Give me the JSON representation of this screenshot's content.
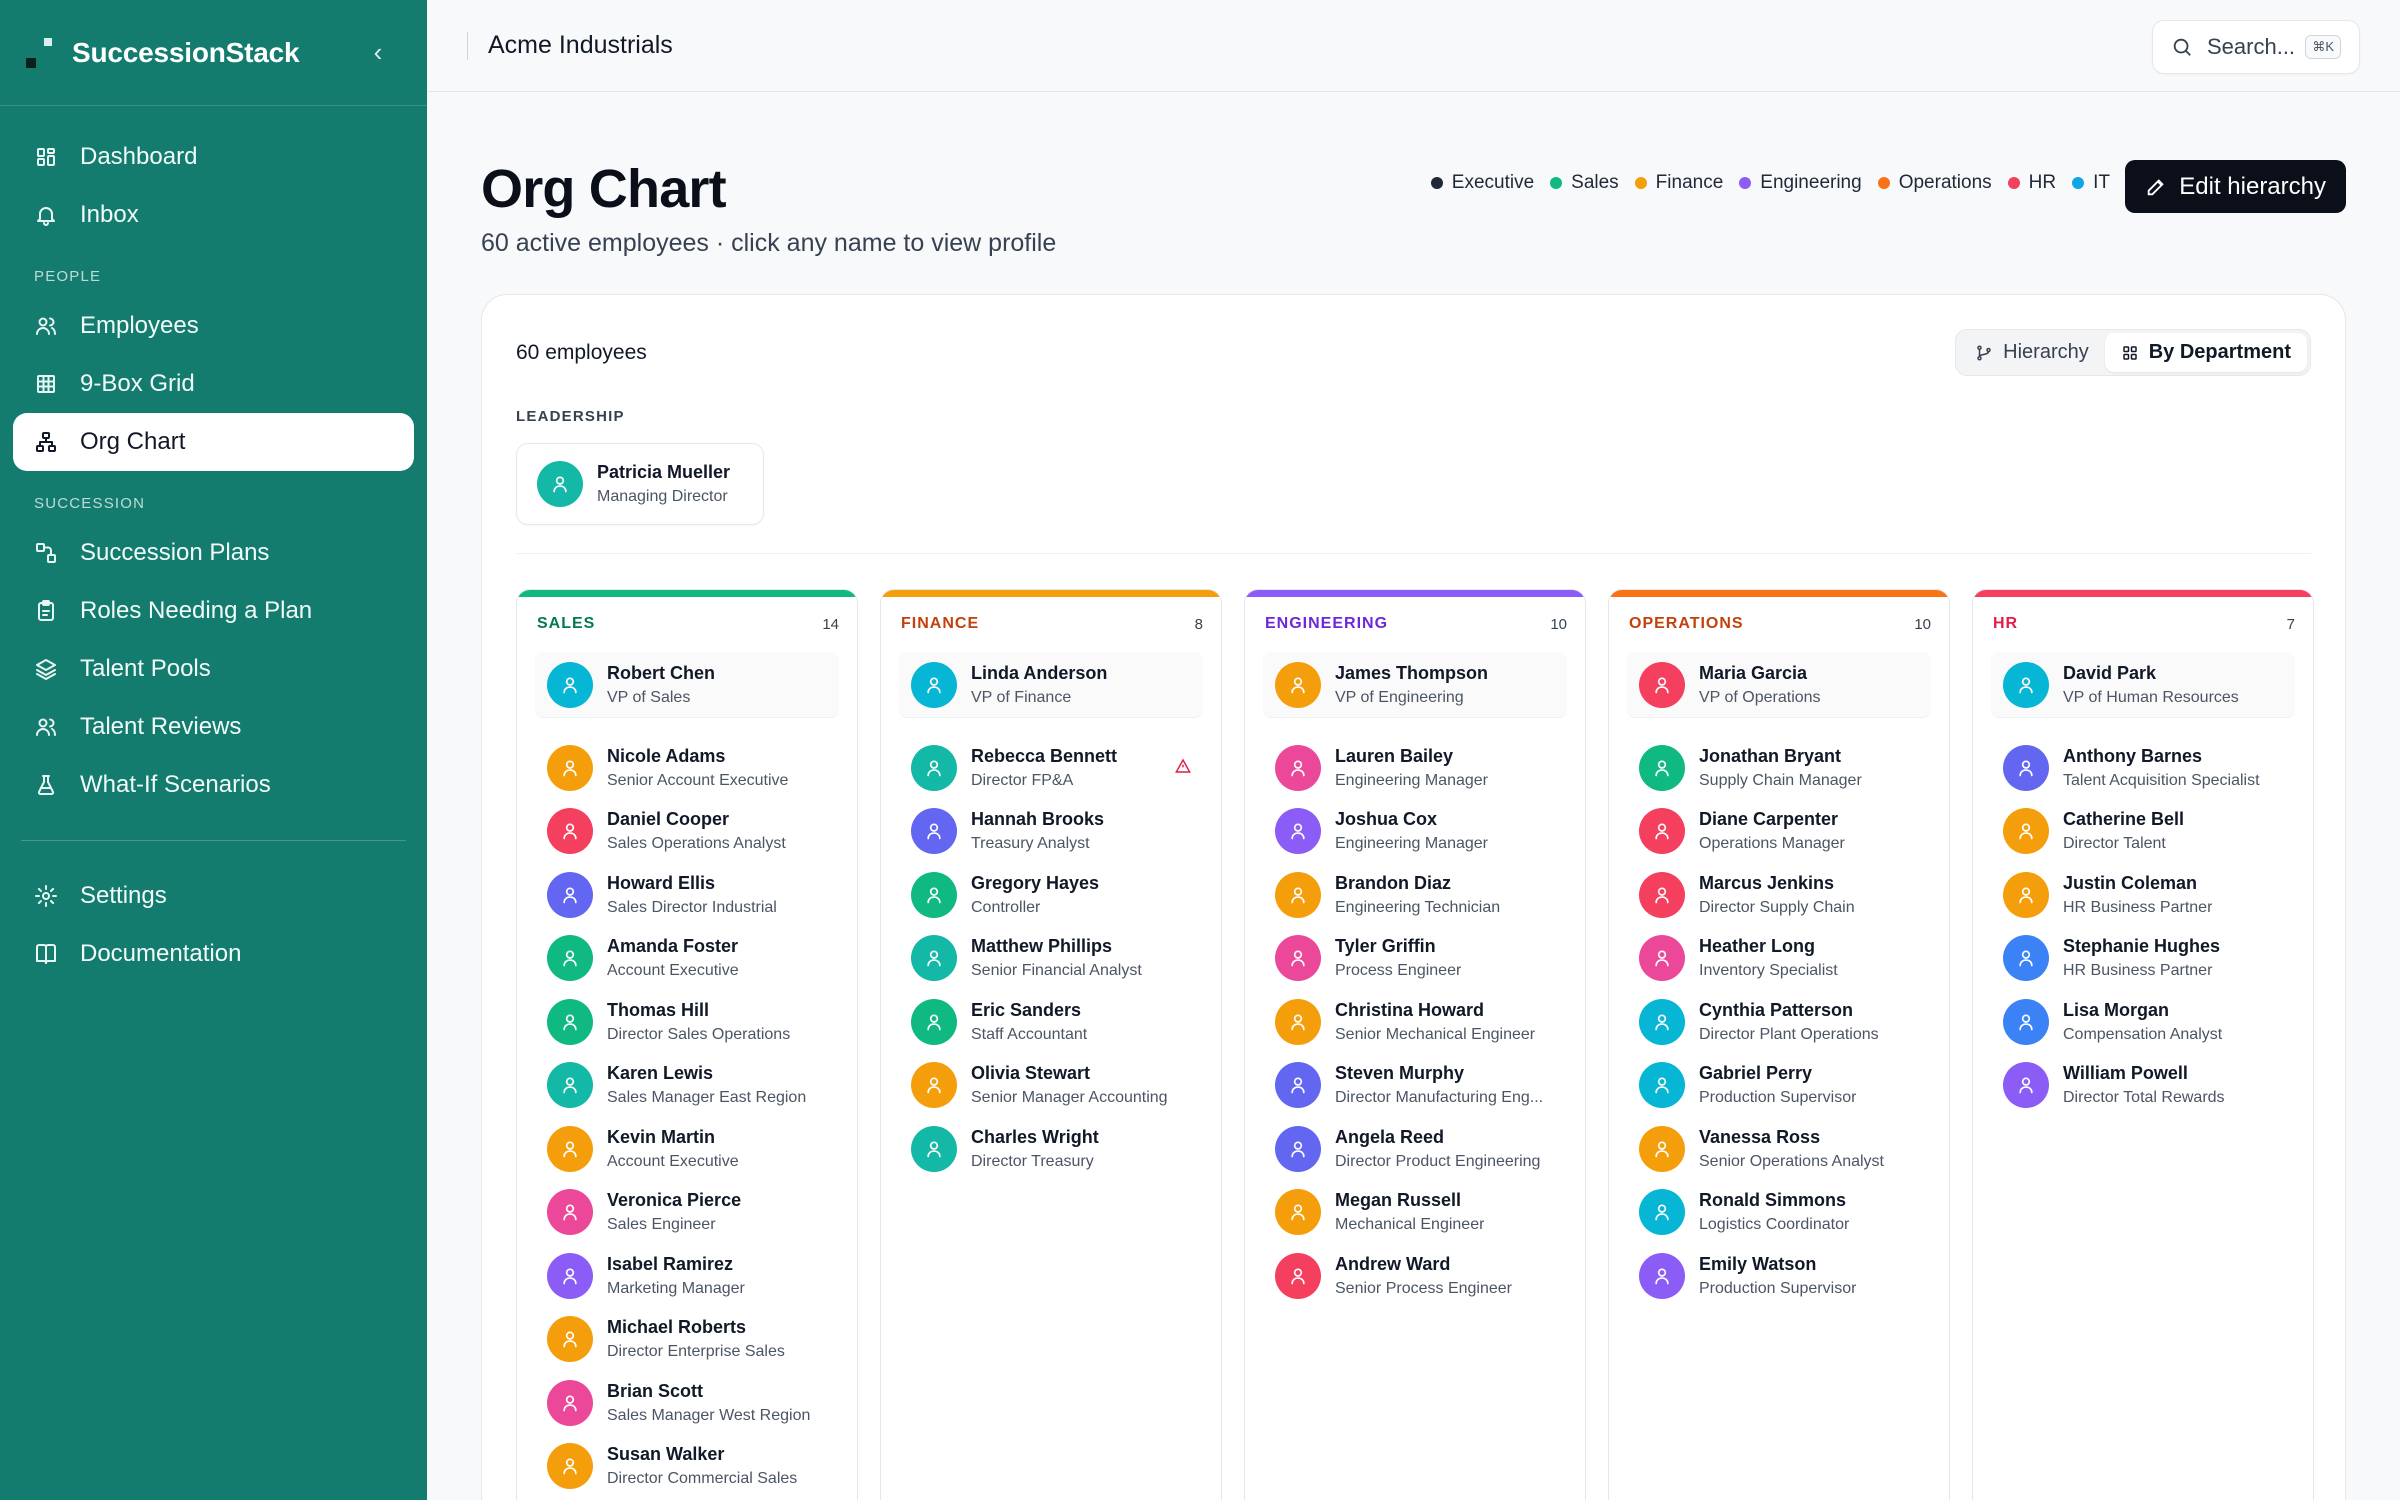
{
  "brand": {
    "name": "SuccessionStack"
  },
  "sidebar": {
    "top": [
      {
        "label": "Dashboard",
        "icon": "dashboard-icon"
      },
      {
        "label": "Inbox",
        "icon": "bell-icon"
      }
    ],
    "people_label": "PEOPLE",
    "people": [
      {
        "label": "Employees",
        "icon": "users-icon"
      },
      {
        "label": "9-Box Grid",
        "icon": "grid-icon"
      },
      {
        "label": "Org Chart",
        "icon": "org-chart-icon",
        "active": true
      }
    ],
    "succession_label": "SUCCESSION",
    "succession": [
      {
        "label": "Succession Plans",
        "icon": "workflow-icon"
      },
      {
        "label": "Roles Needing a Plan",
        "icon": "clipboard-icon"
      },
      {
        "label": "Talent Pools",
        "icon": "layers-icon"
      },
      {
        "label": "Talent Reviews",
        "icon": "user-review-icon"
      },
      {
        "label": "What-If Scenarios",
        "icon": "flask-icon"
      }
    ],
    "bottom": [
      {
        "label": "Settings",
        "icon": "gear-icon"
      },
      {
        "label": "Documentation",
        "icon": "book-icon"
      }
    ]
  },
  "header": {
    "org_name": "Acme Industrials",
    "search_placeholder": "Search...",
    "search_shortcut": "⌘K"
  },
  "page": {
    "title": "Org Chart",
    "subtitle": "60 active employees · click any name to view profile",
    "edit_label": "Edit hierarchy"
  },
  "legend": [
    {
      "label": "Executive",
      "color": "#1f2937"
    },
    {
      "label": "Sales",
      "color": "#10b981"
    },
    {
      "label": "Finance",
      "color": "#f59e0b"
    },
    {
      "label": "Engineering",
      "color": "#8b5cf6"
    },
    {
      "label": "Operations",
      "color": "#f97316"
    },
    {
      "label": "HR",
      "color": "#f43f5e"
    },
    {
      "label": "IT",
      "color": "#0ea5e9"
    }
  ],
  "card": {
    "employee_count": "60 employees",
    "view_hierarchy": "Hierarchy",
    "view_department": "By Department",
    "leadership_label": "LEADERSHIP",
    "leader": {
      "name": "Patricia Mueller",
      "title": "Managing Director",
      "color": "#14b8a6"
    }
  },
  "departments": [
    {
      "name": "SALES",
      "count": "14",
      "bar": "#10b981",
      "title_color": "#047857",
      "head": {
        "name": "Robert Chen",
        "title": "VP of Sales",
        "color": "#06b6d4"
      },
      "members": [
        {
          "name": "Nicole Adams",
          "title": "Senior Account Executive",
          "color": "#f59e0b"
        },
        {
          "name": "Daniel Cooper",
          "title": "Sales Operations Analyst",
          "color": "#f43f5e"
        },
        {
          "name": "Howard Ellis",
          "title": "Sales Director Industrial",
          "color": "#6366f1"
        },
        {
          "name": "Amanda Foster",
          "title": "Account Executive",
          "color": "#10b981"
        },
        {
          "name": "Thomas Hill",
          "title": "Director Sales Operations",
          "color": "#10b981"
        },
        {
          "name": "Karen Lewis",
          "title": "Sales Manager East Region",
          "color": "#14b8a6"
        },
        {
          "name": "Kevin Martin",
          "title": "Account Executive",
          "color": "#f59e0b"
        },
        {
          "name": "Veronica Pierce",
          "title": "Sales Engineer",
          "color": "#ec4899"
        },
        {
          "name": "Isabel Ramirez",
          "title": "Marketing Manager",
          "color": "#8b5cf6"
        },
        {
          "name": "Michael Roberts",
          "title": "Director Enterprise Sales",
          "color": "#f59e0b"
        },
        {
          "name": "Brian Scott",
          "title": "Sales Manager West Region",
          "color": "#ec4899"
        },
        {
          "name": "Susan Walker",
          "title": "Director Commercial Sales",
          "color": "#f59e0b"
        }
      ]
    },
    {
      "name": "FINANCE",
      "count": "8",
      "bar": "#f59e0b",
      "title_color": "#c2410c",
      "head": {
        "name": "Linda Anderson",
        "title": "VP of Finance",
        "color": "#06b6d4"
      },
      "members": [
        {
          "name": "Rebecca Bennett",
          "title": "Director FP&A",
          "color": "#14b8a6",
          "warn": true
        },
        {
          "name": "Hannah Brooks",
          "title": "Treasury Analyst",
          "color": "#6366f1"
        },
        {
          "name": "Gregory Hayes",
          "title": "Controller",
          "color": "#10b981"
        },
        {
          "name": "Matthew Phillips",
          "title": "Senior Financial Analyst",
          "color": "#14b8a6"
        },
        {
          "name": "Eric Sanders",
          "title": "Staff Accountant",
          "color": "#10b981"
        },
        {
          "name": "Olivia Stewart",
          "title": "Senior Manager Accounting",
          "color": "#f59e0b"
        },
        {
          "name": "Charles Wright",
          "title": "Director Treasury",
          "color": "#14b8a6"
        }
      ]
    },
    {
      "name": "ENGINEERING",
      "count": "10",
      "bar": "#8b5cf6",
      "title_color": "#6d28d9",
      "head": {
        "name": "James Thompson",
        "title": "VP of Engineering",
        "color": "#f59e0b"
      },
      "members": [
        {
          "name": "Lauren Bailey",
          "title": "Engineering Manager",
          "color": "#ec4899"
        },
        {
          "name": "Joshua Cox",
          "title": "Engineering Manager",
          "color": "#8b5cf6"
        },
        {
          "name": "Brandon Diaz",
          "title": "Engineering Technician",
          "color": "#f59e0b"
        },
        {
          "name": "Tyler Griffin",
          "title": "Process Engineer",
          "color": "#ec4899"
        },
        {
          "name": "Christina Howard",
          "title": "Senior Mechanical Engineer",
          "color": "#f59e0b"
        },
        {
          "name": "Steven Murphy",
          "title": "Director Manufacturing Eng...",
          "color": "#6366f1"
        },
        {
          "name": "Angela Reed",
          "title": "Director Product Engineering",
          "color": "#6366f1"
        },
        {
          "name": "Megan Russell",
          "title": "Mechanical Engineer",
          "color": "#f59e0b"
        },
        {
          "name": "Andrew Ward",
          "title": "Senior Process Engineer",
          "color": "#f43f5e"
        }
      ]
    },
    {
      "name": "OPERATIONS",
      "count": "10",
      "bar": "#f97316",
      "title_color": "#c2410c",
      "head": {
        "name": "Maria Garcia",
        "title": "VP of Operations",
        "color": "#f43f5e"
      },
      "members": [
        {
          "name": "Jonathan Bryant",
          "title": "Supply Chain Manager",
          "color": "#10b981"
        },
        {
          "name": "Diane Carpenter",
          "title": "Operations Manager",
          "color": "#f43f5e"
        },
        {
          "name": "Marcus Jenkins",
          "title": "Director Supply Chain",
          "color": "#f43f5e"
        },
        {
          "name": "Heather Long",
          "title": "Inventory Specialist",
          "color": "#ec4899"
        },
        {
          "name": "Cynthia Patterson",
          "title": "Director Plant Operations",
          "color": "#06b6d4"
        },
        {
          "name": "Gabriel Perry",
          "title": "Production Supervisor",
          "color": "#06b6d4"
        },
        {
          "name": "Vanessa Ross",
          "title": "Senior Operations Analyst",
          "color": "#f59e0b"
        },
        {
          "name": "Ronald Simmons",
          "title": "Logistics Coordinator",
          "color": "#06b6d4"
        },
        {
          "name": "Emily Watson",
          "title": "Production Supervisor",
          "color": "#8b5cf6"
        }
      ]
    },
    {
      "name": "HR",
      "count": "7",
      "bar": "#f43f5e",
      "title_color": "#e11d48",
      "head": {
        "name": "David Park",
        "title": "VP of Human Resources",
        "color": "#06b6d4"
      },
      "members": [
        {
          "name": "Anthony Barnes",
          "title": "Talent Acquisition Specialist",
          "color": "#6366f1"
        },
        {
          "name": "Catherine Bell",
          "title": "Director Talent",
          "color": "#f59e0b"
        },
        {
          "name": "Justin Coleman",
          "title": "HR Business Partner",
          "color": "#f59e0b"
        },
        {
          "name": "Stephanie Hughes",
          "title": "HR Business Partner",
          "color": "#3b82f6"
        },
        {
          "name": "Lisa Morgan",
          "title": "Compensation Analyst",
          "color": "#3b82f6"
        },
        {
          "name": "William Powell",
          "title": "Director Total Rewards",
          "color": "#8b5cf6"
        }
      ]
    }
  ]
}
